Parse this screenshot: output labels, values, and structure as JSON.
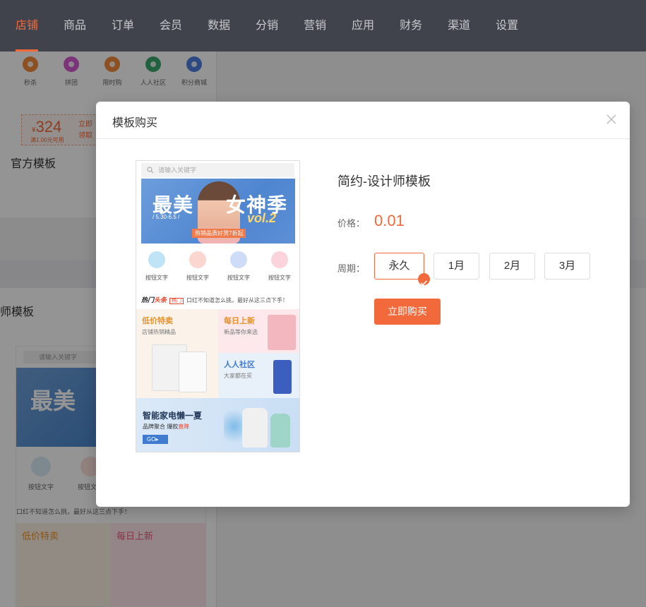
{
  "nav": {
    "items": [
      {
        "label": "店铺",
        "active": true
      },
      {
        "label": "商品"
      },
      {
        "label": "订单"
      },
      {
        "label": "会员"
      },
      {
        "label": "数据"
      },
      {
        "label": "分销"
      },
      {
        "label": "营销"
      },
      {
        "label": "应用"
      },
      {
        "label": "财务"
      },
      {
        "label": "渠道"
      },
      {
        "label": "设置"
      }
    ]
  },
  "background": {
    "quick_icons": [
      {
        "label": "秒杀",
        "color": "#f28a3c"
      },
      {
        "label": "拼团",
        "color": "#d65bd0"
      },
      {
        "label": "限时购",
        "color": "#f28a3c"
      },
      {
        "label": "人人社区",
        "color": "#3aa86f"
      },
      {
        "label": "积分商城",
        "color": "#4f7fe0"
      }
    ],
    "coupon": {
      "amount": "324",
      "currency": "¥",
      "condition": "满1.00元可用",
      "action_1": "立即",
      "action_2": "领取"
    },
    "section_title": "官方模板",
    "section_title_2": "师模板",
    "card": {
      "search_placeholder": "请输入关键字",
      "banner_text": "最美",
      "button_labels": [
        "按钮文字",
        "按钮文字"
      ],
      "headline": "口红不知道怎么挑，最好从这三点下手！",
      "grid_titles": [
        "低价特卖",
        "每日上新"
      ]
    }
  },
  "modal": {
    "title": "模板购买",
    "close_icon": "close-icon",
    "template_name": "简约-设计师模板",
    "price_label": "价格：",
    "price_value": "0.01",
    "period_label": "周期：",
    "periods": [
      "永久",
      "1月",
      "2月",
      "3月"
    ],
    "selected_period": "永久",
    "buy_label": "立即购买",
    "accent_color": "#f26a3c"
  },
  "preview": {
    "search_placeholder": "请输入关键字",
    "banner": {
      "title_1": "最美",
      "title_2": "女神季",
      "vol": "vol.2",
      "date": "/ 5.30-6.5 /",
      "tag": "热销品质好货7折起"
    },
    "buttons": [
      {
        "label": "按钮文字",
        "color": "#bfe4f6"
      },
      {
        "label": "按钮文字",
        "color": "#fbd6d0"
      },
      {
        "label": "按钮文字",
        "color": "#cfdcf7"
      },
      {
        "label": "按钮文字",
        "color": "#fbd3da"
      }
    ],
    "headline": {
      "hot_1": "热门",
      "hot_2": "头条",
      "tag": "热门",
      "text": "口红不知道怎么挑，最好从这三点下手！"
    },
    "grid": {
      "left": {
        "title": "低价特卖",
        "sub": "店铺热销精品"
      },
      "right_top": {
        "title": "每日上新",
        "sub": "新品等你来选"
      },
      "right_bottom": {
        "title": "人人社区",
        "sub": "大家都在买"
      }
    },
    "appliance": {
      "title": "智能家电懒一夏",
      "sub_1": "品牌聚合 爆款",
      "sub_2": "直降",
      "go": "GO"
    }
  }
}
